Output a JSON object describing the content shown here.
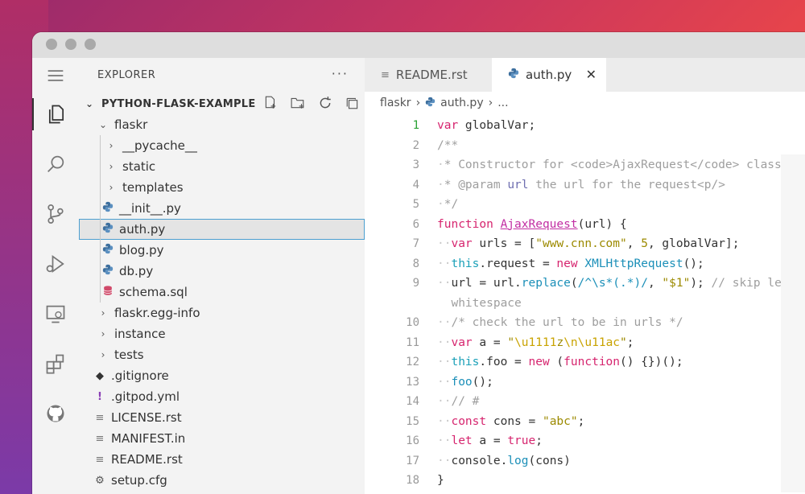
{
  "sidebar": {
    "title": "EXPLORER",
    "more": "···",
    "project": "PYTHON-FLASK-EXAMPLE",
    "tree": [
      {
        "label": "flaskr",
        "kind": "folder-open",
        "depth": 1
      },
      {
        "label": "__pycache__",
        "kind": "folder",
        "depth": 2
      },
      {
        "label": "static",
        "kind": "folder",
        "depth": 2
      },
      {
        "label": "templates",
        "kind": "folder",
        "depth": 2
      },
      {
        "label": "__init__.py",
        "kind": "py",
        "depth": 2
      },
      {
        "label": "auth.py",
        "kind": "py",
        "depth": 2,
        "selected": true
      },
      {
        "label": "blog.py",
        "kind": "py",
        "depth": 2
      },
      {
        "label": "db.py",
        "kind": "py",
        "depth": 2
      },
      {
        "label": "schema.sql",
        "kind": "sql",
        "depth": 2
      },
      {
        "label": "flaskr.egg-info",
        "kind": "folder",
        "depth": 1
      },
      {
        "label": "instance",
        "kind": "folder",
        "depth": 1
      },
      {
        "label": "tests",
        "kind": "folder",
        "depth": 1
      },
      {
        "label": ".gitignore",
        "kind": "git",
        "depth": 1
      },
      {
        "label": ".gitpod.yml",
        "kind": "yml",
        "depth": 1
      },
      {
        "label": "LICENSE.rst",
        "kind": "txt",
        "depth": 1
      },
      {
        "label": "MANIFEST.in",
        "kind": "txt",
        "depth": 1
      },
      {
        "label": "README.rst",
        "kind": "txt",
        "depth": 1
      },
      {
        "label": "setup.cfg",
        "kind": "cfg",
        "depth": 1
      }
    ]
  },
  "tabs": [
    {
      "label": "README.rst",
      "icon": "text-file-icon"
    },
    {
      "label": "auth.py",
      "icon": "python-icon",
      "active": true,
      "close": "✕"
    }
  ],
  "breadcrumb": {
    "folder": "flaskr",
    "file": "auth.py",
    "more": "..."
  },
  "code": {
    "line_numbers": [
      "1",
      "2",
      "3",
      "4",
      "5",
      "6",
      "7",
      "8",
      "9",
      "",
      "10",
      "11",
      "12",
      "13",
      "14",
      "15",
      "16",
      "17",
      "18"
    ]
  },
  "colors": {
    "accent": "#4c9fd0",
    "current_line": "#2aa134"
  }
}
